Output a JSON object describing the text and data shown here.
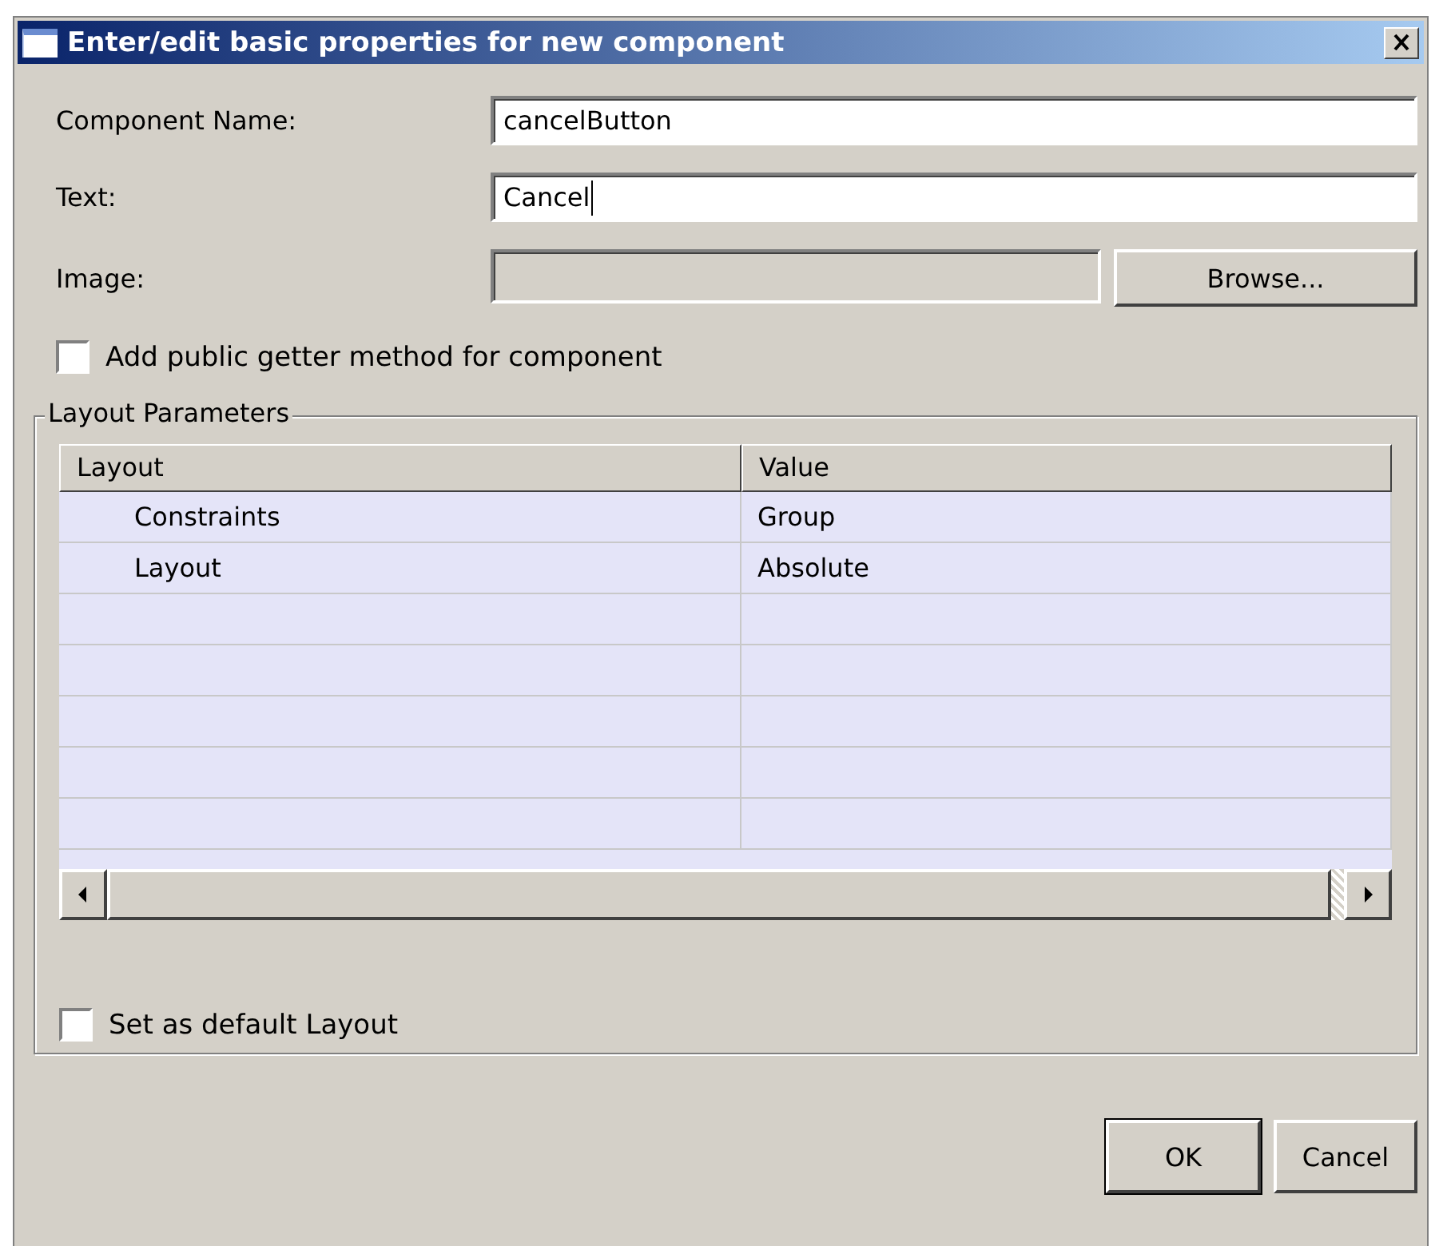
{
  "window": {
    "title": "Enter/edit basic properties for new component"
  },
  "fields": [
    {
      "label": "Component Name:",
      "value": "cancelButton",
      "disabled": false
    },
    {
      "label": "Text:",
      "value": "Cancel",
      "disabled": false,
      "focused": true
    },
    {
      "label": "Image:",
      "disabled": true,
      "button": "Browse..."
    }
  ],
  "getter_checkbox": {
    "label": "Add public getter method for component",
    "checked": false
  },
  "layout_group": {
    "title": "Layout Parameters",
    "columns": [
      "Layout",
      "Value"
    ],
    "rows": [
      {
        "cells": [
          "Constraints",
          "Group"
        ]
      },
      {
        "cells": [
          "Layout",
          "Absolute"
        ]
      }
    ],
    "default_checkbox": {
      "label": "Set as default Layout",
      "checked": false
    }
  },
  "buttons": [
    {
      "label": "OK",
      "default": true
    },
    {
      "label": "Cancel",
      "default": false
    }
  ]
}
